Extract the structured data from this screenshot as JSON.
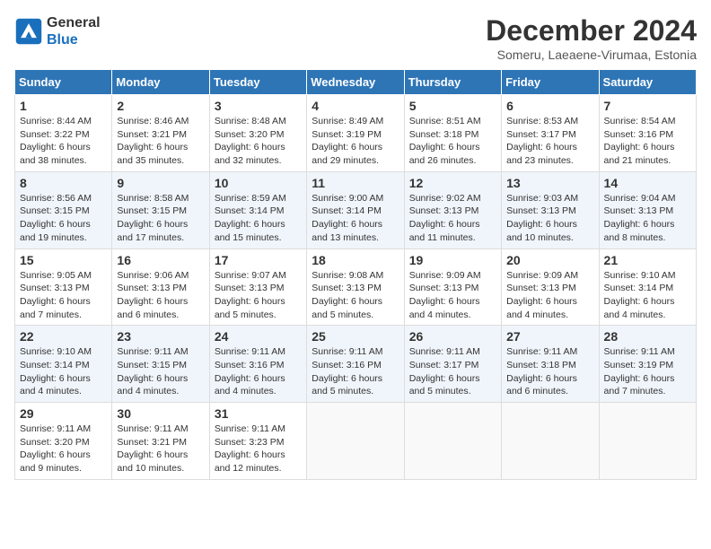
{
  "header": {
    "logo": {
      "general": "General",
      "blue": "Blue"
    },
    "title": "December 2024",
    "subtitle": "Someru, Laeaene-Virumaa, Estonia"
  },
  "calendar": {
    "days_of_week": [
      "Sunday",
      "Monday",
      "Tuesday",
      "Wednesday",
      "Thursday",
      "Friday",
      "Saturday"
    ],
    "weeks": [
      [
        {
          "day": "1",
          "sunrise": "Sunrise: 8:44 AM",
          "sunset": "Sunset: 3:22 PM",
          "daylight": "Daylight: 6 hours and 38 minutes."
        },
        {
          "day": "2",
          "sunrise": "Sunrise: 8:46 AM",
          "sunset": "Sunset: 3:21 PM",
          "daylight": "Daylight: 6 hours and 35 minutes."
        },
        {
          "day": "3",
          "sunrise": "Sunrise: 8:48 AM",
          "sunset": "Sunset: 3:20 PM",
          "daylight": "Daylight: 6 hours and 32 minutes."
        },
        {
          "day": "4",
          "sunrise": "Sunrise: 8:49 AM",
          "sunset": "Sunset: 3:19 PM",
          "daylight": "Daylight: 6 hours and 29 minutes."
        },
        {
          "day": "5",
          "sunrise": "Sunrise: 8:51 AM",
          "sunset": "Sunset: 3:18 PM",
          "daylight": "Daylight: 6 hours and 26 minutes."
        },
        {
          "day": "6",
          "sunrise": "Sunrise: 8:53 AM",
          "sunset": "Sunset: 3:17 PM",
          "daylight": "Daylight: 6 hours and 23 minutes."
        },
        {
          "day": "7",
          "sunrise": "Sunrise: 8:54 AM",
          "sunset": "Sunset: 3:16 PM",
          "daylight": "Daylight: 6 hours and 21 minutes."
        }
      ],
      [
        {
          "day": "8",
          "sunrise": "Sunrise: 8:56 AM",
          "sunset": "Sunset: 3:15 PM",
          "daylight": "Daylight: 6 hours and 19 minutes."
        },
        {
          "day": "9",
          "sunrise": "Sunrise: 8:58 AM",
          "sunset": "Sunset: 3:15 PM",
          "daylight": "Daylight: 6 hours and 17 minutes."
        },
        {
          "day": "10",
          "sunrise": "Sunrise: 8:59 AM",
          "sunset": "Sunset: 3:14 PM",
          "daylight": "Daylight: 6 hours and 15 minutes."
        },
        {
          "day": "11",
          "sunrise": "Sunrise: 9:00 AM",
          "sunset": "Sunset: 3:14 PM",
          "daylight": "Daylight: 6 hours and 13 minutes."
        },
        {
          "day": "12",
          "sunrise": "Sunrise: 9:02 AM",
          "sunset": "Sunset: 3:13 PM",
          "daylight": "Daylight: 6 hours and 11 minutes."
        },
        {
          "day": "13",
          "sunrise": "Sunrise: 9:03 AM",
          "sunset": "Sunset: 3:13 PM",
          "daylight": "Daylight: 6 hours and 10 minutes."
        },
        {
          "day": "14",
          "sunrise": "Sunrise: 9:04 AM",
          "sunset": "Sunset: 3:13 PM",
          "daylight": "Daylight: 6 hours and 8 minutes."
        }
      ],
      [
        {
          "day": "15",
          "sunrise": "Sunrise: 9:05 AM",
          "sunset": "Sunset: 3:13 PM",
          "daylight": "Daylight: 6 hours and 7 minutes."
        },
        {
          "day": "16",
          "sunrise": "Sunrise: 9:06 AM",
          "sunset": "Sunset: 3:13 PM",
          "daylight": "Daylight: 6 hours and 6 minutes."
        },
        {
          "day": "17",
          "sunrise": "Sunrise: 9:07 AM",
          "sunset": "Sunset: 3:13 PM",
          "daylight": "Daylight: 6 hours and 5 minutes."
        },
        {
          "day": "18",
          "sunrise": "Sunrise: 9:08 AM",
          "sunset": "Sunset: 3:13 PM",
          "daylight": "Daylight: 6 hours and 5 minutes."
        },
        {
          "day": "19",
          "sunrise": "Sunrise: 9:09 AM",
          "sunset": "Sunset: 3:13 PM",
          "daylight": "Daylight: 6 hours and 4 minutes."
        },
        {
          "day": "20",
          "sunrise": "Sunrise: 9:09 AM",
          "sunset": "Sunset: 3:13 PM",
          "daylight": "Daylight: 6 hours and 4 minutes."
        },
        {
          "day": "21",
          "sunrise": "Sunrise: 9:10 AM",
          "sunset": "Sunset: 3:14 PM",
          "daylight": "Daylight: 6 hours and 4 minutes."
        }
      ],
      [
        {
          "day": "22",
          "sunrise": "Sunrise: 9:10 AM",
          "sunset": "Sunset: 3:14 PM",
          "daylight": "Daylight: 6 hours and 4 minutes."
        },
        {
          "day": "23",
          "sunrise": "Sunrise: 9:11 AM",
          "sunset": "Sunset: 3:15 PM",
          "daylight": "Daylight: 6 hours and 4 minutes."
        },
        {
          "day": "24",
          "sunrise": "Sunrise: 9:11 AM",
          "sunset": "Sunset: 3:16 PM",
          "daylight": "Daylight: 6 hours and 4 minutes."
        },
        {
          "day": "25",
          "sunrise": "Sunrise: 9:11 AM",
          "sunset": "Sunset: 3:16 PM",
          "daylight": "Daylight: 6 hours and 5 minutes."
        },
        {
          "day": "26",
          "sunrise": "Sunrise: 9:11 AM",
          "sunset": "Sunset: 3:17 PM",
          "daylight": "Daylight: 6 hours and 5 minutes."
        },
        {
          "day": "27",
          "sunrise": "Sunrise: 9:11 AM",
          "sunset": "Sunset: 3:18 PM",
          "daylight": "Daylight: 6 hours and 6 minutes."
        },
        {
          "day": "28",
          "sunrise": "Sunrise: 9:11 AM",
          "sunset": "Sunset: 3:19 PM",
          "daylight": "Daylight: 6 hours and 7 minutes."
        }
      ],
      [
        {
          "day": "29",
          "sunrise": "Sunrise: 9:11 AM",
          "sunset": "Sunset: 3:20 PM",
          "daylight": "Daylight: 6 hours and 9 minutes."
        },
        {
          "day": "30",
          "sunrise": "Sunrise: 9:11 AM",
          "sunset": "Sunset: 3:21 PM",
          "daylight": "Daylight: 6 hours and 10 minutes."
        },
        {
          "day": "31",
          "sunrise": "Sunrise: 9:11 AM",
          "sunset": "Sunset: 3:23 PM",
          "daylight": "Daylight: 6 hours and 12 minutes."
        },
        null,
        null,
        null,
        null
      ]
    ]
  }
}
